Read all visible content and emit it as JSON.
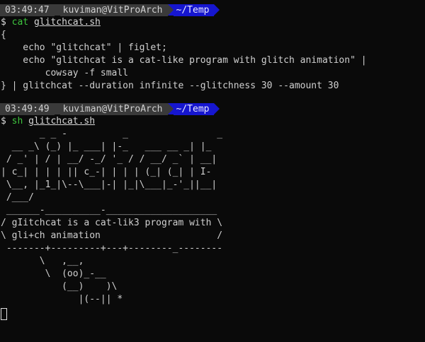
{
  "prompt1": {
    "time": "03:49:47",
    "user": "kuviman@VitProArch",
    "dir": "~/Temp"
  },
  "cmd1": {
    "dollar": "$",
    "command": "cat",
    "file": "glitchcat.sh"
  },
  "file_contents": [
    "{",
    "    echo \"glitchcat\" | figlet;",
    "    echo \"glitchcat is a cat-like program with glitch animation\" |",
    "        cowsay -f small",
    "} | glitchcat --duration infinite --glitchness 30 --amount 30"
  ],
  "prompt2": {
    "time": "03:49:49",
    "user": "kuviman@VitProArch",
    "dir": "~/Temp"
  },
  "cmd2": {
    "dollar": "$",
    "command": "sh",
    "file": "glitchcat.sh"
  },
  "output_lines": [
    "       _ _ -          _                _",
    "  __ _\\ (_) |_ ___| |-_   ___ __ _| |_",
    " / _' | / | __/ -_/ '_ / / __/ _` | __|",
    "| c_| | | | || c_-| | | | (_| (_| | I-",
    " \\__, |_1_|\\--\\___|-| |_|\\___|_-'_||__|",
    " /___/",
    " ______-__________-____________________",
    "/ gIitchcat is a cat-lik3 program with \\",
    "\\ gli+ch animation                     /",
    " -------+---------+---+--------_--------",
    "       \\   ,__,",
    "        \\  (oo)_-__",
    "           (__)    )\\",
    "              |(--|| *"
  ]
}
